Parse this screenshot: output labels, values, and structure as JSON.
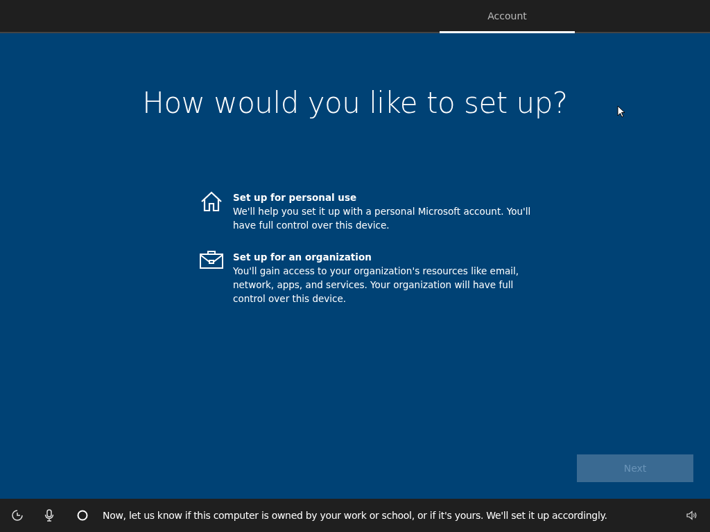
{
  "tabs": [
    {
      "label": "Account",
      "selected": true
    }
  ],
  "title": "How would you like to set up?",
  "options": [
    {
      "kind": "home",
      "title": "Set up for personal use",
      "description": "We'll help you set it up with a personal Microsoft account. You'll have full control over this device.",
      "selected": false
    },
    {
      "kind": "briefcase",
      "title": "Set up for an organization",
      "description": "You'll gain access to your organization's resources like email, network, apps, and services. Your organization will have full control over this device.",
      "selected": false
    }
  ],
  "next_button": {
    "label": "Next",
    "disabled": true
  },
  "status_bar": {
    "message": "Now, let us know if this computer is owned by your work or school, or if it's yours. We'll set it up accordingly."
  }
}
